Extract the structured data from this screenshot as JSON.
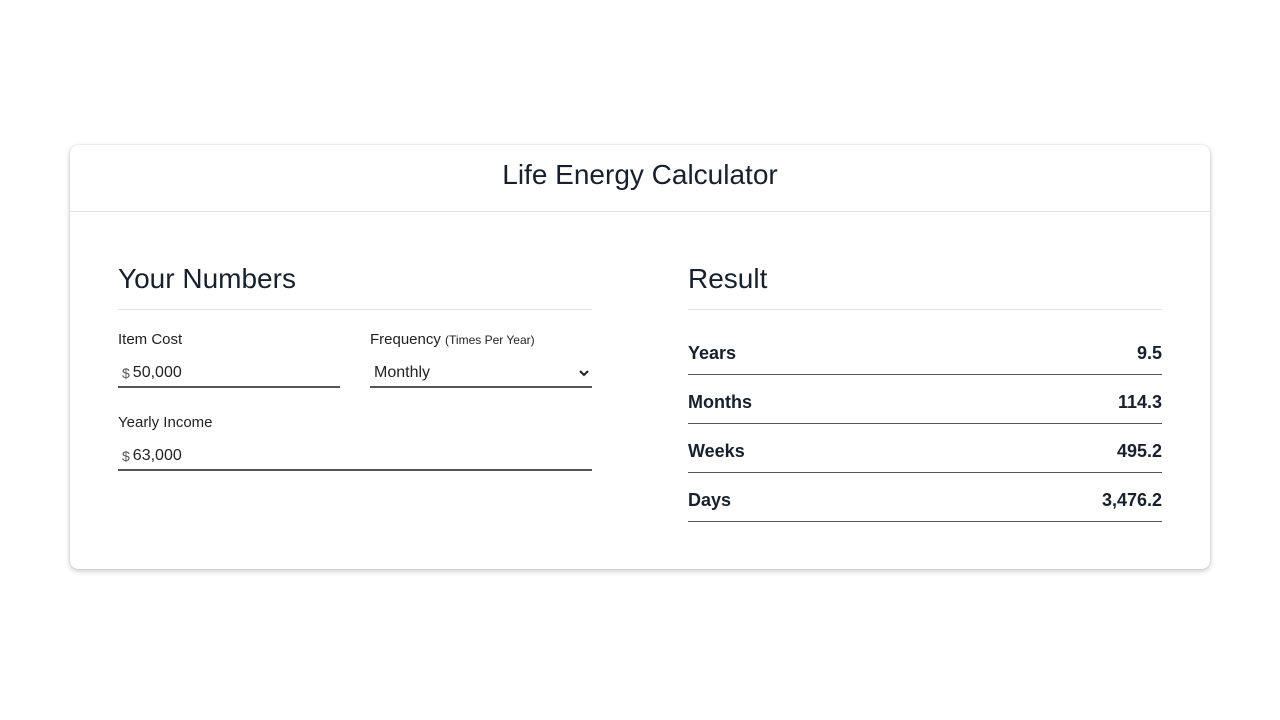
{
  "header": {
    "title": "Life Energy Calculator"
  },
  "inputs": {
    "title": "Your Numbers",
    "item_cost": {
      "label": "Item Cost",
      "prefix": "$",
      "value": "50,000"
    },
    "frequency": {
      "label": "Frequency",
      "hint": "(Times Per Year)",
      "selected": "Monthly"
    },
    "yearly_income": {
      "label": "Yearly Income",
      "prefix": "$",
      "value": "63,000"
    }
  },
  "result": {
    "title": "Result",
    "rows": [
      {
        "label": "Years",
        "value": "9.5"
      },
      {
        "label": "Months",
        "value": "114.3"
      },
      {
        "label": "Weeks",
        "value": "495.2"
      },
      {
        "label": "Days",
        "value": "3,476.2"
      }
    ]
  },
  "icons": {
    "select_chevron": "chevron-down-icon"
  }
}
